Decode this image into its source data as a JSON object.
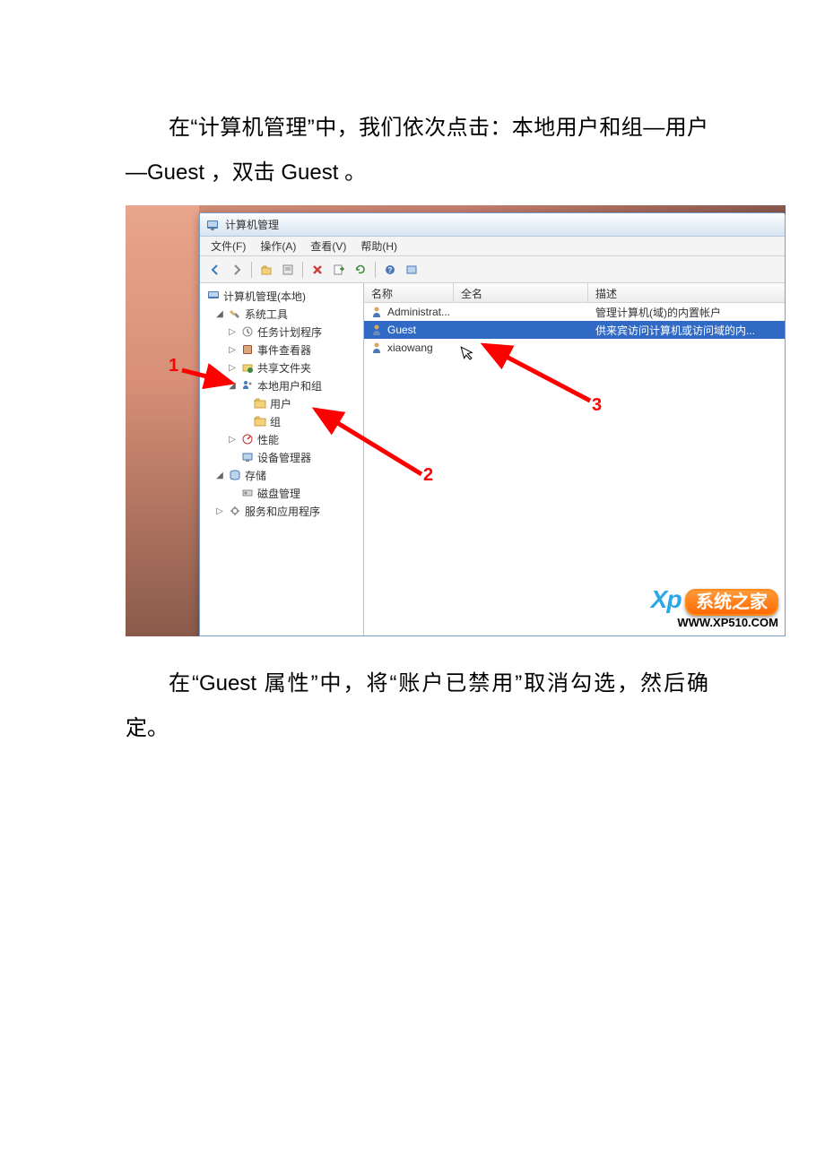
{
  "paragraphs": {
    "p1": "在“计算机管理”中，我们依次点击：本地用户和组—用户—Guest ，双击 Guest 。",
    "p2": "在“Guest 属性”中，将“账户已禁用”取消勾选，然后确定。"
  },
  "window": {
    "title": "计算机管理",
    "menus": {
      "file": "文件(F)",
      "action": "操作(A)",
      "view": "查看(V)",
      "help": "帮助(H)"
    },
    "tree": {
      "root": "计算机管理(本地)",
      "system_tools": "系统工具",
      "task_scheduler": "任务计划程序",
      "event_viewer": "事件查看器",
      "shared_folders": "共享文件夹",
      "local_users_groups": "本地用户和组",
      "users": "用户",
      "groups": "组",
      "performance": "性能",
      "device_manager": "设备管理器",
      "storage": "存储",
      "disk_management": "磁盘管理",
      "services_apps": "服务和应用程序"
    },
    "columns": {
      "name": "名称",
      "fullname": "全名",
      "description": "描述"
    },
    "users": [
      {
        "name": "Administrat...",
        "fullname": "",
        "desc": "管理计算机(域)的内置帐户"
      },
      {
        "name": "Guest",
        "fullname": "",
        "desc": "供来宾访问计算机或访问域的内..."
      },
      {
        "name": "xiaowang",
        "fullname": "",
        "desc": ""
      }
    ]
  },
  "annotations": {
    "a1": "1",
    "a2": "2",
    "a3": "3"
  },
  "watermark": {
    "brand_cn": "系统之家",
    "url": "WWW.XP510.COM"
  }
}
